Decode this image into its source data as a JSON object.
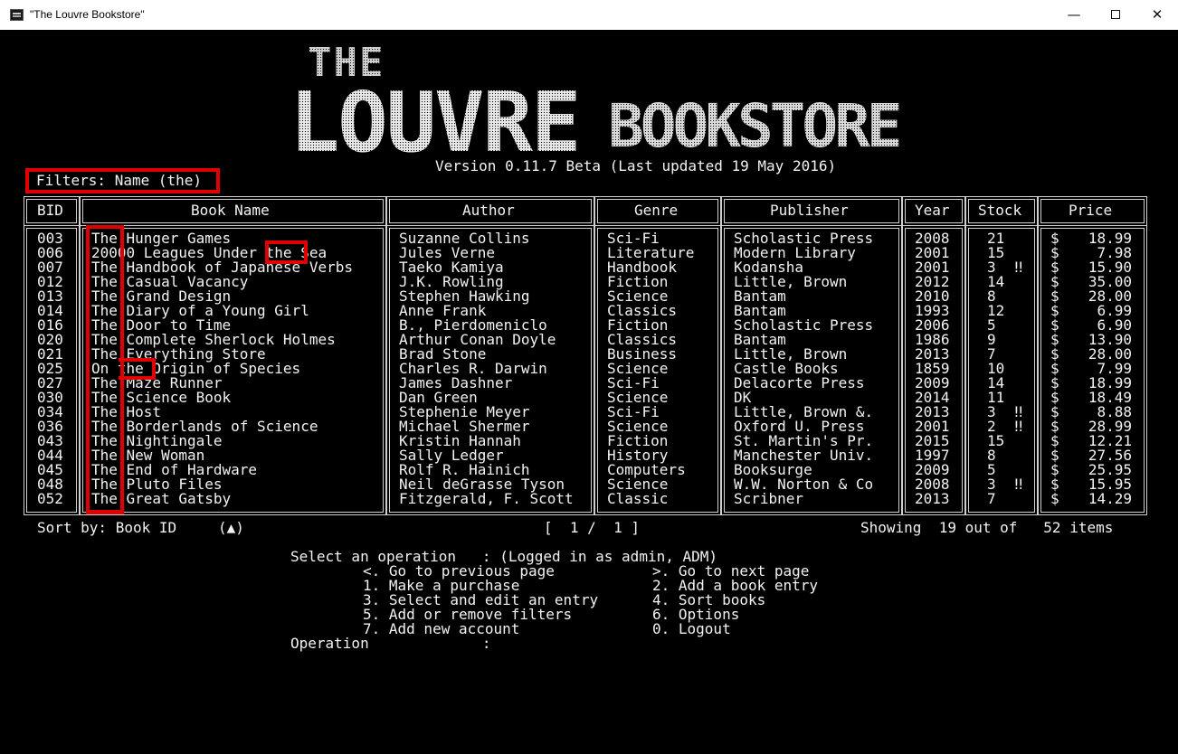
{
  "window": {
    "title": "\"The Louvre Bookstore\"",
    "minimize": "—",
    "close": "✕"
  },
  "logo": {
    "line1": "THE",
    "line2": "LOUVRE",
    "line3": "BOOKSTORE"
  },
  "version": "Version 0.11.7 Beta (Last updated 19 May 2016)",
  "filters": "Filters: Name (the)",
  "columns": [
    "BID",
    "Book Name",
    "Author",
    "Genre",
    "Publisher",
    "Year",
    "Stock",
    "Price"
  ],
  "rows": [
    {
      "bid": "003",
      "name": "The Hunger Games",
      "author": "Suzanne Collins",
      "genre": "Sci-Fi",
      "publisher": "Scholastic Press",
      "year": "2008",
      "stock": "21",
      "flag": "",
      "cur": "$",
      "price": "18.99"
    },
    {
      "bid": "006",
      "name": "20000 Leagues Under the Sea",
      "author": "Jules Verne",
      "genre": "Literature",
      "publisher": "Modern Library",
      "year": "2001",
      "stock": "15",
      "flag": "",
      "cur": "$",
      "price": "7.98"
    },
    {
      "bid": "007",
      "name": "The Handbook of Japanese Verbs",
      "author": "Taeko Kamiya",
      "genre": "Handbook",
      "publisher": "Kodansha",
      "year": "2001",
      "stock": "3",
      "flag": "‼",
      "cur": "$",
      "price": "15.90"
    },
    {
      "bid": "012",
      "name": "The Casual Vacancy",
      "author": "J.K. Rowling",
      "genre": "Fiction",
      "publisher": "Little, Brown",
      "year": "2012",
      "stock": "14",
      "flag": "",
      "cur": "$",
      "price": "35.00"
    },
    {
      "bid": "013",
      "name": "The Grand Design",
      "author": "Stephen Hawking",
      "genre": "Science",
      "publisher": "Bantam",
      "year": "2010",
      "stock": "8",
      "flag": "",
      "cur": "$",
      "price": "28.00"
    },
    {
      "bid": "014",
      "name": "The Diary of a Young Girl",
      "author": "Anne Frank",
      "genre": "Classics",
      "publisher": "Bantam",
      "year": "1993",
      "stock": "12",
      "flag": "",
      "cur": "$",
      "price": "6.99"
    },
    {
      "bid": "016",
      "name": "The Door to Time",
      "author": "B., Pierdomeniclo",
      "genre": "Fiction",
      "publisher": "Scholastic Press",
      "year": "2006",
      "stock": "5",
      "flag": "",
      "cur": "$",
      "price": "6.90"
    },
    {
      "bid": "020",
      "name": "The Complete Sherlock Holmes",
      "author": "Arthur Conan Doyle",
      "genre": "Classics",
      "publisher": "Bantam",
      "year": "1986",
      "stock": "9",
      "flag": "",
      "cur": "$",
      "price": "13.90"
    },
    {
      "bid": "021",
      "name": "The Everything Store",
      "author": "Brad Stone",
      "genre": "Business",
      "publisher": "Little, Brown",
      "year": "2013",
      "stock": "7",
      "flag": "",
      "cur": "$",
      "price": "28.00"
    },
    {
      "bid": "025",
      "name": "On the Origin of Species",
      "author": "Charles R. Darwin",
      "genre": "Science",
      "publisher": "Castle Books",
      "year": "1859",
      "stock": "10",
      "flag": "",
      "cur": "$",
      "price": "7.99"
    },
    {
      "bid": "027",
      "name": "The Maze Runner",
      "author": "James Dashner",
      "genre": "Sci-Fi",
      "publisher": "Delacorte Press",
      "year": "2009",
      "stock": "14",
      "flag": "",
      "cur": "$",
      "price": "18.99"
    },
    {
      "bid": "030",
      "name": "The Science Book",
      "author": "Dan Green",
      "genre": "Science",
      "publisher": "DK",
      "year": "2014",
      "stock": "11",
      "flag": "",
      "cur": "$",
      "price": "18.49"
    },
    {
      "bid": "034",
      "name": "The Host",
      "author": "Stephenie Meyer",
      "genre": "Sci-Fi",
      "publisher": "Little, Brown &.",
      "year": "2013",
      "stock": "3",
      "flag": "‼",
      "cur": "$",
      "price": "8.88"
    },
    {
      "bid": "036",
      "name": "The Borderlands of Science",
      "author": "Michael Shermer",
      "genre": "Science",
      "publisher": "Oxford U. Press",
      "year": "2001",
      "stock": "2",
      "flag": "‼",
      "cur": "$",
      "price": "28.99"
    },
    {
      "bid": "043",
      "name": "The Nightingale",
      "author": "Kristin Hannah",
      "genre": "Fiction",
      "publisher": "St. Martin's Pr.",
      "year": "2015",
      "stock": "15",
      "flag": "",
      "cur": "$",
      "price": "12.21"
    },
    {
      "bid": "044",
      "name": "The New Woman",
      "author": "Sally Ledger",
      "genre": "History",
      "publisher": "Manchester Univ.",
      "year": "1997",
      "stock": "8",
      "flag": "",
      "cur": "$",
      "price": "27.56"
    },
    {
      "bid": "045",
      "name": "The End of Hardware",
      "author": "Rolf R. Hainich",
      "genre": "Computers",
      "publisher": "Booksurge",
      "year": "2009",
      "stock": "5",
      "flag": "",
      "cur": "$",
      "price": "25.95"
    },
    {
      "bid": "048",
      "name": "The Pluto Files",
      "author": "Neil deGrasse Tyson",
      "genre": "Science",
      "publisher": "W.W. Norton & Co",
      "year": "2008",
      "stock": "3",
      "flag": "‼",
      "cur": "$",
      "price": "15.95"
    },
    {
      "bid": "052",
      "name": "The Great Gatsby",
      "author": "Fitzgerald, F. Scott",
      "genre": "Classic",
      "publisher": "Scribner",
      "year": "2013",
      "stock": "7",
      "flag": "",
      "cur": "$",
      "price": "14.29"
    }
  ],
  "footer": {
    "sort": "Sort by: Book ID",
    "sort_arrow": "(▲)",
    "page": "[  1 /  1 ]",
    "showing": "Showing  19 out of   52 items"
  },
  "menu": {
    "prompt": "Select an operation   : (Logged in as admin, ADM)",
    "left": [
      "<. Go to previous page",
      "1. Make a purchase",
      "3. Select and edit an entry",
      "5. Add or remove filters",
      "7. Add new account"
    ],
    "right": [
      ">. Go to next page",
      "2. Add a book entry",
      "4. Sort books",
      "6. Options",
      "0. Logout"
    ],
    "input": "Operation             :"
  }
}
